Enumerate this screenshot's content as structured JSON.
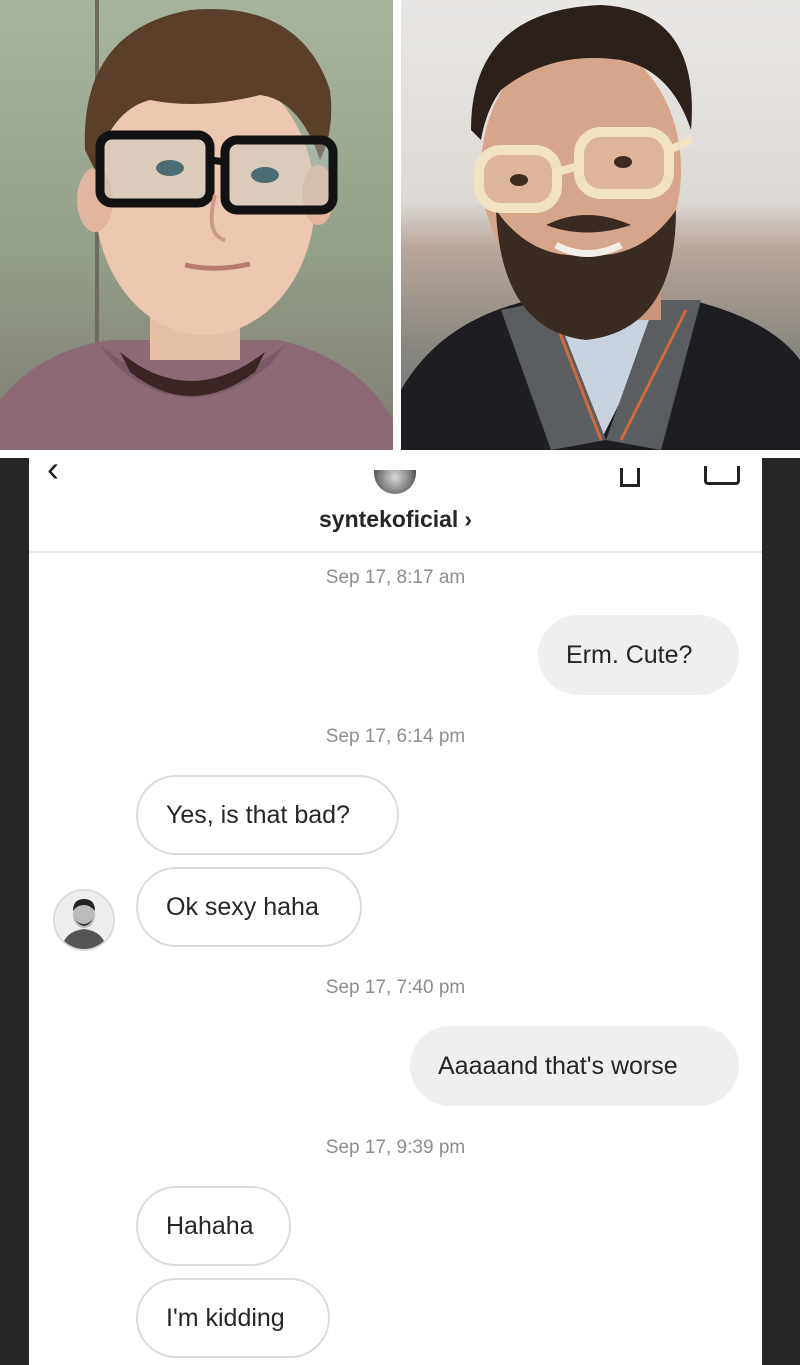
{
  "conversation": {
    "username": "syntekoficial",
    "chevron": "›",
    "back_glyph": "‹"
  },
  "messages": [
    {
      "kind": "timestamp",
      "text": "Sep 17, 8:17 am"
    },
    {
      "kind": "outgoing",
      "text": "Erm.  Cute?"
    },
    {
      "kind": "timestamp",
      "text": "Sep 17, 6:14 pm"
    },
    {
      "kind": "incoming",
      "text": "Yes, is that bad?"
    },
    {
      "kind": "incoming",
      "text": "Ok sexy haha"
    },
    {
      "kind": "timestamp",
      "text": "Sep 17, 7:40 pm"
    },
    {
      "kind": "outgoing",
      "text": "Aaaaand that's worse"
    },
    {
      "kind": "timestamp",
      "text": "Sep 17, 9:39 pm"
    },
    {
      "kind": "incoming",
      "text": "Hahaha"
    },
    {
      "kind": "incoming",
      "text": "I'm kidding"
    }
  ],
  "icons": {
    "header_left": "back-arrow-icon",
    "header_right_1": "info-icon",
    "header_right_2": "video-call-icon"
  },
  "colors": {
    "outgoing_bubble": "#efefef",
    "incoming_border": "#dbdbdb",
    "timestamp_text": "#8e8e8e",
    "phone_frame": "#262626"
  }
}
